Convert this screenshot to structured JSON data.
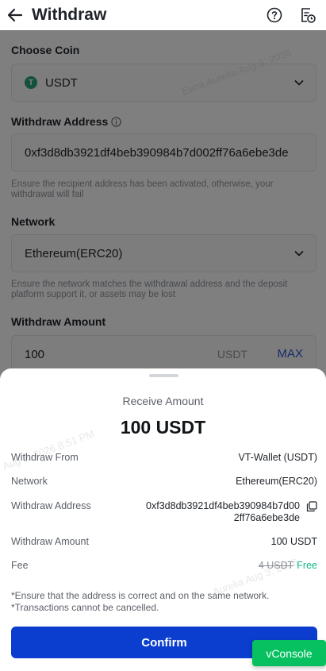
{
  "header": {
    "title": "Withdraw",
    "back_icon": "arrow-left-icon",
    "help_icon": "question-circle-icon",
    "history_icon": "history-record-icon"
  },
  "form": {
    "coin": {
      "label": "Choose Coin",
      "value": "USDT",
      "badge": "T"
    },
    "address": {
      "label": "Withdraw Address",
      "value": "0xf3d8db3921df4beb390984b7d002ff76a6ebe3de",
      "hint": "Ensure the recipient address has been activated, otherwise, your withdrawal will fail"
    },
    "network": {
      "label": "Network",
      "value": "Ethereum(ERC20)",
      "hint": "Ensure the network matches the withdrawal address and the deposit platform support it, or assets may be lost"
    },
    "amount": {
      "label": "Withdraw Amount",
      "value": "100",
      "unit": "USDT",
      "max_label": "MAX"
    }
  },
  "sheet": {
    "caption": "Receive Amount",
    "amount": "100 USDT",
    "rows": {
      "from": {
        "label": "Withdraw From",
        "value": "VT-Wallet (USDT)"
      },
      "network": {
        "label": "Network",
        "value": "Ethereum(ERC20)"
      },
      "address": {
        "label": "Withdraw Address",
        "value": "0xf3d8db3921df4beb390984b7d002ff76a6ebe3de"
      },
      "amount": {
        "label": "Withdraw Amount",
        "value": "100 USDT"
      },
      "fee": {
        "label": "Fee",
        "old_value": "4 USDT",
        "value": "Free"
      }
    },
    "notes": [
      "*Ensure that the address is correct and on the same network.",
      "*Transactions cannot be cancelled."
    ],
    "confirm_label": "Confirm"
  },
  "vconsole_label": "vConsole",
  "watermarks": [
    "Evna Aurelia Aug 3, 2026",
    "Aug 3, 2026 8:51 PM",
    "Aurelia Aug 3, 2026"
  ],
  "colors": {
    "primary": "#0b3ecf",
    "free": "#12b886",
    "vconsole": "#07c160",
    "usdt": "#26a17b"
  }
}
